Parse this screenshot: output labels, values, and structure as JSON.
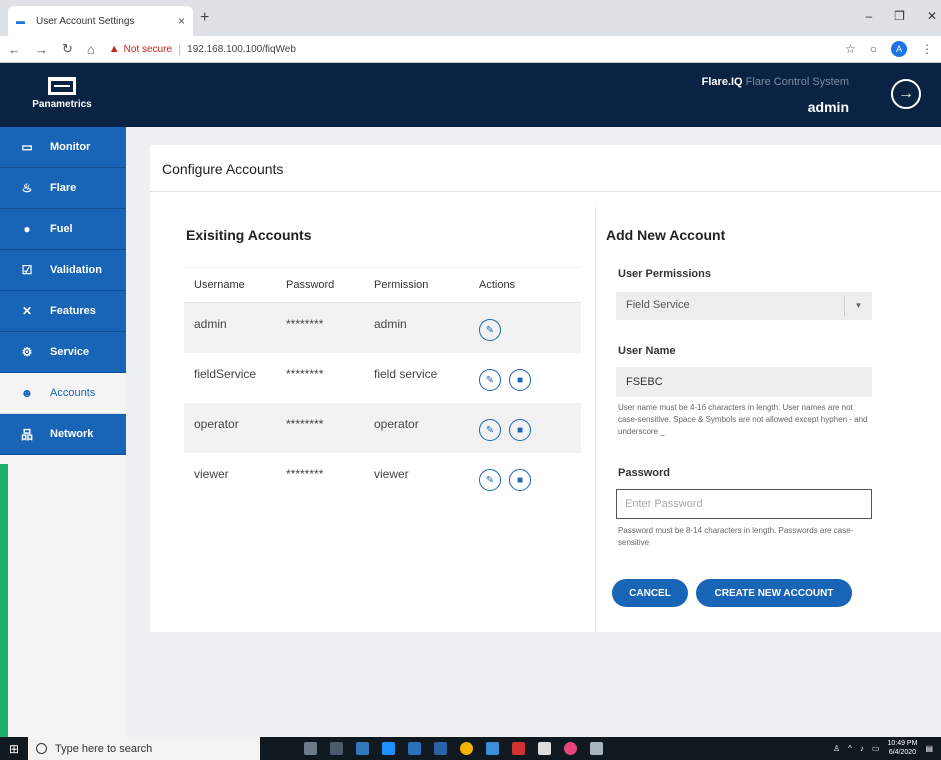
{
  "browser": {
    "tab_title": "User Account Settings",
    "tab_close": "×",
    "new_tab": "+",
    "not_secure": "Not secure",
    "url": "192.168.100.100/fiqWeb"
  },
  "header": {
    "logo_text": "Panametrics",
    "product_bold": "Flare.IQ",
    "product_rest": " Flare Control System",
    "user": "admin"
  },
  "sidebar": {
    "items": [
      {
        "label": "Monitor",
        "icon": "monitor-icon"
      },
      {
        "label": "Flare",
        "icon": "flame-icon"
      },
      {
        "label": "Fuel",
        "icon": "drop-icon"
      },
      {
        "label": "Validation",
        "icon": "check-icon"
      },
      {
        "label": "Features",
        "icon": "tools-icon"
      },
      {
        "label": "Service",
        "icon": "gears-icon"
      },
      {
        "label": "Accounts",
        "icon": "users-icon"
      },
      {
        "label": "Network",
        "icon": "network-icon"
      }
    ]
  },
  "page": {
    "title": "Configure Accounts"
  },
  "existing": {
    "title": "Exisiting Accounts",
    "headers": [
      "Username",
      "Password",
      "Permission",
      "Actions"
    ],
    "rows": [
      {
        "username": "admin",
        "password": "********",
        "permission": "admin"
      },
      {
        "username": "fieldService",
        "password": "********",
        "permission": "field service"
      },
      {
        "username": "operator",
        "password": "********",
        "permission": "operator"
      },
      {
        "username": "viewer",
        "password": "********",
        "permission": "viewer"
      }
    ]
  },
  "new_account": {
    "title": "Add New Account",
    "permissions_label": "User Permissions",
    "permissions_value": "Field Service",
    "username_label": "User Name",
    "username_value": "FSEBC",
    "username_hint": "User name must be 4-16 characters in length. User names are not case-sensitive. Space & Symbols are not allowed except hyphen - and underscore _",
    "password_label": "Password",
    "password_placeholder": "Enter Password",
    "password_hint": "Password must be 8-14 characters in length. Passwords are case-sensitive",
    "cancel_label": "CANCEL",
    "create_label": "CREATE NEW ACCOUNT"
  },
  "taskbar": {
    "search_placeholder": "Type here to search",
    "time": "10:49 PM",
    "date": "6/4/2020"
  },
  "colors": {
    "header_bg": "#0a2342",
    "nav_blue": "#1865b8",
    "accent_green": "#1cb06b"
  }
}
